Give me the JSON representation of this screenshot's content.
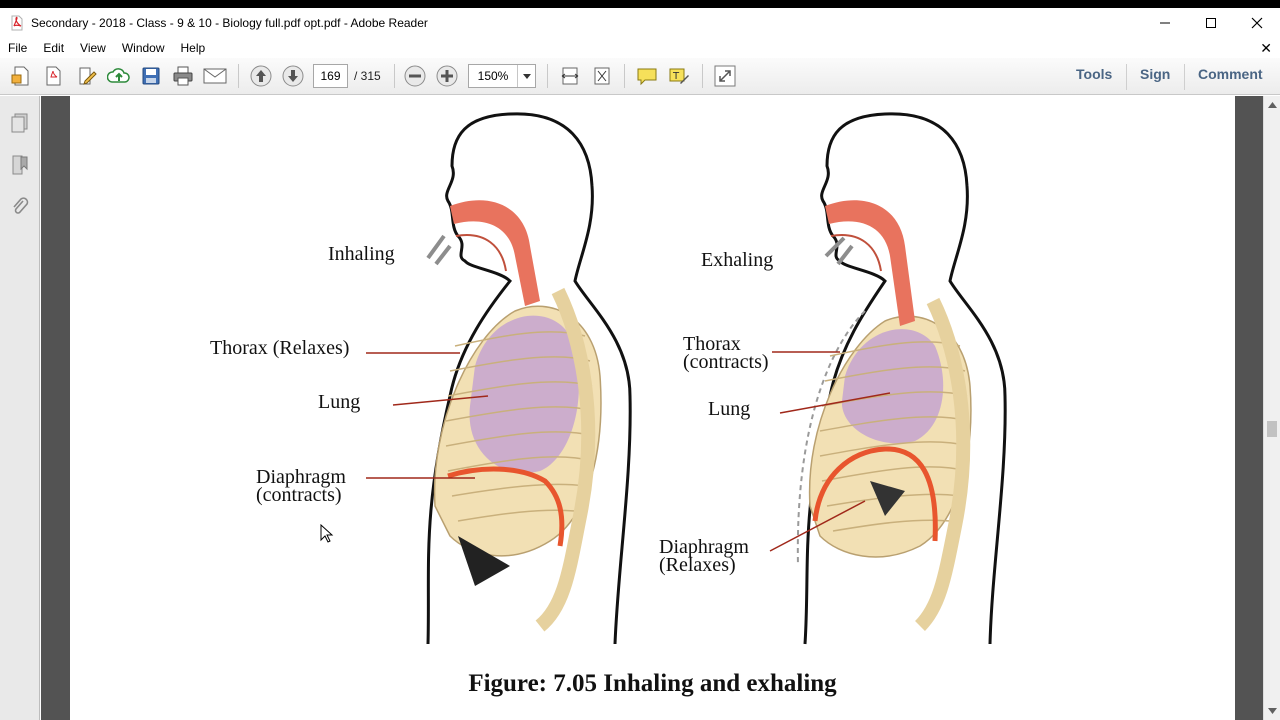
{
  "window": {
    "title": "Secondary - 2018 - Class - 9 & 10 - Biology full.pdf opt.pdf - Adobe Reader"
  },
  "menu": {
    "items": [
      "File",
      "Edit",
      "View",
      "Window",
      "Help"
    ]
  },
  "toolbar": {
    "current_page": "169",
    "total_pages": "/ 315",
    "zoom": "150%",
    "tools_label": "Tools",
    "sign_label": "Sign",
    "comment_label": "Comment"
  },
  "icons": {
    "create": "create-pdf-icon",
    "open": "open-icon",
    "edit": "edit-pdf-icon",
    "upload": "upload-cloud-icon",
    "save": "save-icon",
    "print": "print-icon",
    "email": "email-icon",
    "prev": "previous-page-icon",
    "next": "next-page-icon",
    "zoom_out": "zoom-out-icon",
    "zoom_in": "zoom-in-icon",
    "fit_width": "fit-width-icon",
    "fit_page": "fit-page-icon",
    "comment": "sticky-note-icon",
    "highlight": "highlight-text-icon",
    "fullscreen": "full-screen-icon"
  },
  "figure": {
    "left": {
      "action": "Inhaling",
      "thorax": "Thorax (Relaxes)",
      "lung": "Lung",
      "diaphragm_line1": "Diaphragm",
      "diaphragm_line2": "(contracts)"
    },
    "right": {
      "action": "Exhaling",
      "thorax_line1": "Thorax",
      "thorax_line2": "(contracts)",
      "lung": "Lung",
      "diaphragm_line1": "Diaphragm",
      "diaphragm_line2": "(Relaxes)"
    },
    "caption": "Figure: 7.05 Inhaling and exhaling"
  },
  "colors": {
    "airway": "#e8735e",
    "lung": "#c6a3d0",
    "ribs": "#f2e0b4",
    "diaphragm": "#e8552e",
    "label_line": "#a0281a",
    "toolbar_right_text": "#4a6584",
    "doc_background": "#535353"
  }
}
